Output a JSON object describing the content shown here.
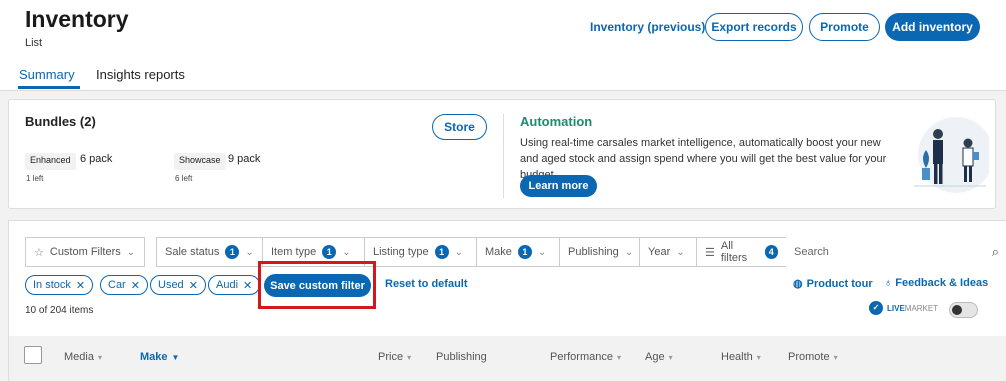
{
  "header": {
    "title": "Inventory",
    "subtitle": "List",
    "previous_link": "Inventory (previous)",
    "export_label": "Export records",
    "promote_label": "Promote",
    "add_label": "Add inventory"
  },
  "tabs": [
    {
      "label": "Summary",
      "active": true
    },
    {
      "label": "Insights reports",
      "active": false
    }
  ],
  "bundles": {
    "title": "Bundles (2)",
    "store_label": "Store",
    "packs": [
      {
        "tag": "Enhanced",
        "value": "6 pack",
        "left": "1 left"
      },
      {
        "tag": "Showcase",
        "value": "9 pack",
        "left": "6 left"
      }
    ]
  },
  "automation": {
    "title": "Automation",
    "text": "Using real-time carsales market intelligence, automatically boost your new and aged stock and assign spend where you will get the best value for your budget.",
    "cta_label": "Learn more"
  },
  "filters": {
    "custom_filters": "Custom Filters",
    "sale_status": {
      "label": "Sale status",
      "count": "1"
    },
    "item_type": {
      "label": "Item type",
      "count": "1"
    },
    "listing_type": {
      "label": "Listing type",
      "count": "1"
    },
    "make": {
      "label": "Make",
      "count": "1"
    },
    "publishing": "Publishing",
    "year": "Year",
    "all_filters": {
      "label": "All filters",
      "count": "4"
    },
    "search_placeholder": "Search"
  },
  "chips": [
    "In stock",
    "Car",
    "Used",
    "Audi"
  ],
  "actions": {
    "save_label": "Save custom filter",
    "reset_label": "Reset to default",
    "tour_label": "Product tour",
    "feedback_label": "Feedback & Ideas"
  },
  "results": {
    "count_text": "10 of 204 items",
    "livemarket_live": "LIVE",
    "livemarket_market": "MARKET"
  },
  "table": {
    "columns": [
      "Media",
      "Make",
      "Price",
      "Publishing",
      "Performance",
      "Age",
      "Health",
      "Promote"
    ],
    "sorted_column": "Make"
  },
  "colors": {
    "accent": "#0b67b1",
    "automation": "#1f8a70",
    "highlight": "#d5161b"
  }
}
